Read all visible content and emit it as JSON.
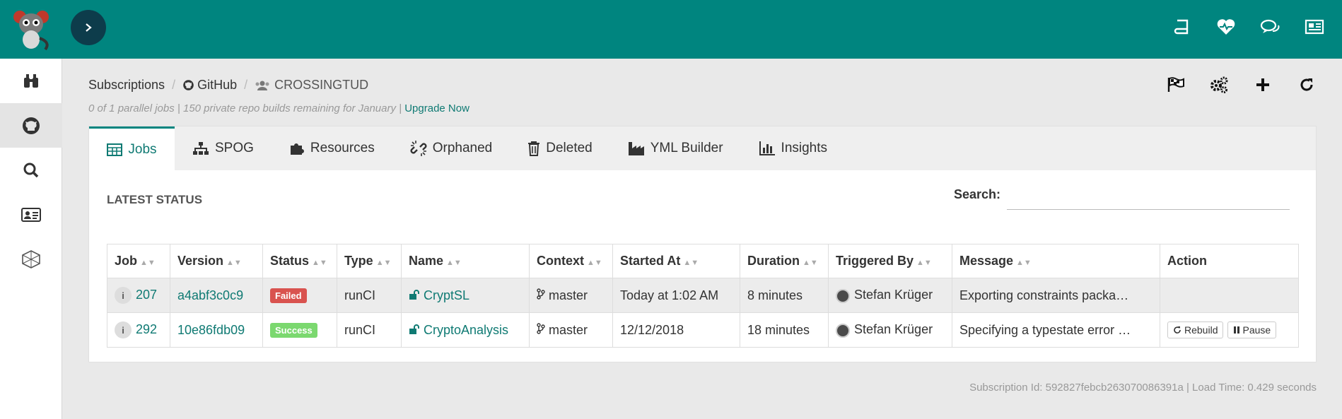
{
  "breadcrumb": {
    "subscriptions": "Subscriptions",
    "provider": "GitHub",
    "org": "CROSSINGTUD"
  },
  "subscription_info": {
    "text": "0 of 1 parallel jobs | 150 private repo builds remaining for January |",
    "upgrade_link": "Upgrade Now"
  },
  "tabs": [
    {
      "label": "Jobs",
      "icon": "table-icon",
      "active": true
    },
    {
      "label": "SPOG",
      "icon": "sitemap-icon"
    },
    {
      "label": "Resources",
      "icon": "puzzle-icon"
    },
    {
      "label": "Orphaned",
      "icon": "unlink-icon"
    },
    {
      "label": "Deleted",
      "icon": "trash-icon"
    },
    {
      "label": "YML Builder",
      "icon": "industry-icon"
    },
    {
      "label": "Insights",
      "icon": "bar-chart-icon"
    }
  ],
  "section_title": "LATEST STATUS",
  "search": {
    "label": "Search:",
    "value": "",
    "placeholder": ""
  },
  "table": {
    "headers": [
      "Job",
      "Version",
      "Status",
      "Type",
      "Name",
      "Context",
      "Started At",
      "Duration",
      "Triggered By",
      "Message",
      "Action"
    ],
    "rows": [
      {
        "job": "207",
        "version": "a4abf3c0c9",
        "status": "Failed",
        "type": "runCI",
        "name": "CryptSL",
        "context": "master",
        "started": "Today at 1:02 AM",
        "duration": "8 minutes",
        "triggered": "Stefan Krüger",
        "message": "Exporting constraints packa…"
      },
      {
        "job": "292",
        "version": "10e86fdb09",
        "status": "Success",
        "type": "runCI",
        "name": "CryptoAnalysis",
        "context": "master",
        "started": "12/12/2018",
        "duration": "18 minutes",
        "triggered": "Stefan Krüger",
        "message": "Specifying a typestate error …",
        "rebuild": "Rebuild",
        "pause": "Pause"
      }
    ]
  },
  "footer": "Subscription Id: 592827febcb263070086391a | Load Time: 0.429 seconds",
  "colors": {
    "brand": "#00857f",
    "toggle": "#0d3c4b",
    "link": "#0f7a73",
    "failed": "#d9534f",
    "success": "#7bd86f"
  }
}
